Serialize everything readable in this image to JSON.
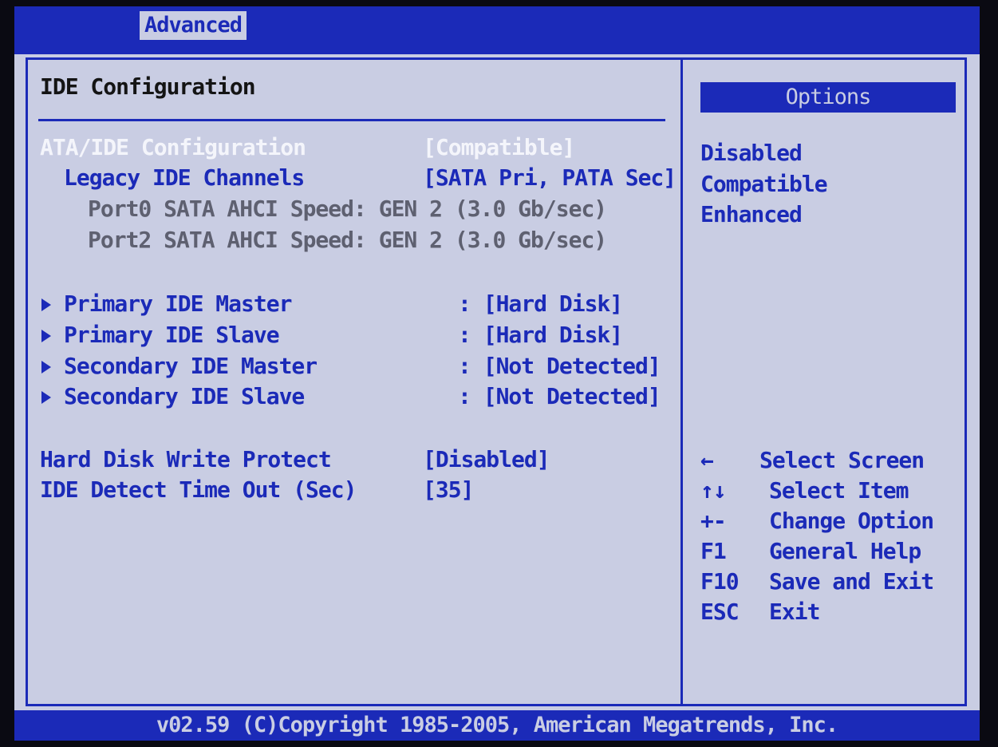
{
  "topbar": {
    "tab": "Advanced"
  },
  "main": {
    "title": "IDE Configuration",
    "settings": [
      {
        "label": "ATA/IDE Configuration",
        "value": "[Compatible]"
      },
      {
        "label": "Legacy IDE Channels",
        "value": "[SATA Pri, PATA Sec]"
      },
      {
        "label": "Port0 SATA AHCI Speed: GEN 2 (3.0 Gb/sec)"
      },
      {
        "label": "Port2 SATA AHCI Speed: GEN 2 (3.0 Gb/sec)"
      }
    ],
    "devices": [
      {
        "label": "Primary IDE Master",
        "value": ": [Hard Disk]"
      },
      {
        "label": "Primary IDE Slave",
        "value": ": [Hard Disk]"
      },
      {
        "label": "Secondary IDE Master",
        "value": ": [Not Detected]"
      },
      {
        "label": "Secondary IDE Slave",
        "value": ": [Not Detected]"
      }
    ],
    "extra": [
      {
        "label": "Hard Disk Write Protect",
        "value": "[Disabled]"
      },
      {
        "label": "IDE Detect Time Out (Sec)",
        "value": "[35]"
      }
    ]
  },
  "options": {
    "header": "Options",
    "items": [
      "Disabled",
      "Compatible",
      "Enhanced"
    ]
  },
  "help": [
    {
      "key": "←",
      "action": "Select Screen"
    },
    {
      "key": "↑↓",
      "action": "Select Item"
    },
    {
      "key": "+-",
      "action": "Change Option"
    },
    {
      "key": "F1",
      "action": "General Help"
    },
    {
      "key": "F10",
      "action": "Save and Exit"
    },
    {
      "key": "ESC",
      "action": "Exit"
    }
  ],
  "footer": {
    "copyright": "v02.59 (C)Copyright 1985-2005, American Megatrends, Inc."
  },
  "colors": {
    "accent": "#1b2ab8",
    "background": "#c9cde3",
    "selected": "#f4f5fb",
    "info": "#5e6070"
  }
}
